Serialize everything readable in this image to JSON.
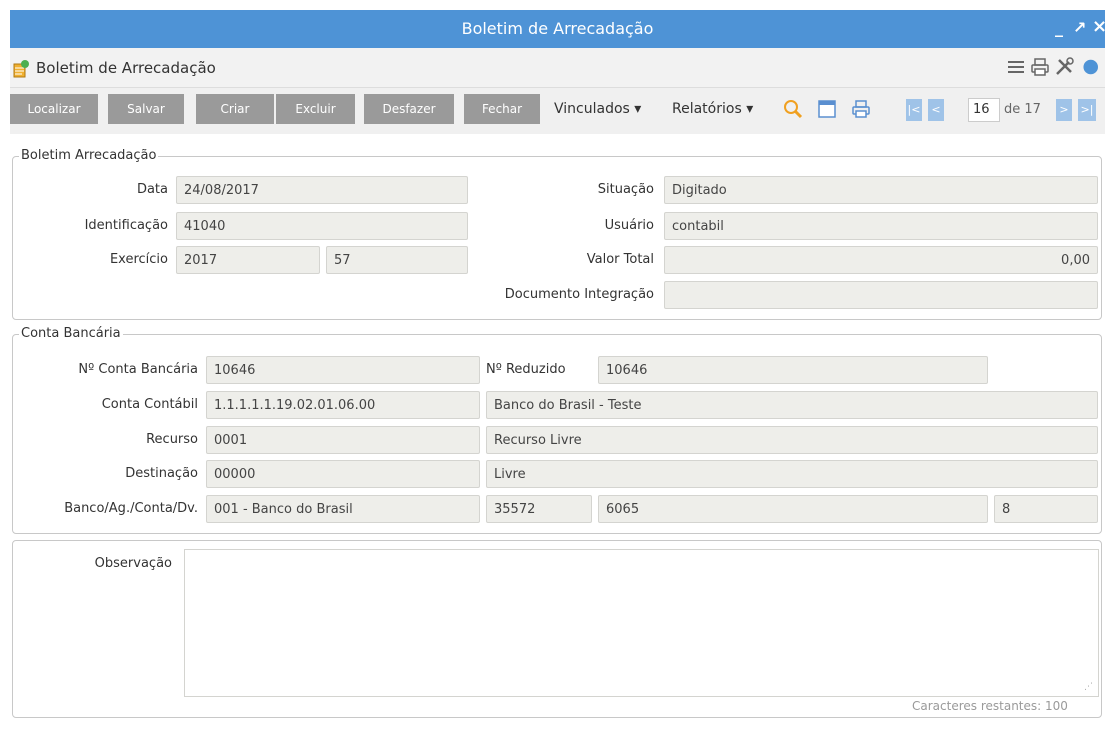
{
  "window": {
    "title": "Boletim de Arrecadação",
    "minimize_glyph": "_",
    "maximize_glyph": "↗",
    "close_glyph": "×"
  },
  "header": {
    "title": "Boletim de Arrecadação",
    "icons": [
      "menu-icon",
      "print-icon",
      "tools-icon",
      "help-icon"
    ]
  },
  "toolbar": {
    "buttons": [
      "Localizar",
      "Salvar",
      "Criar",
      "Excluir",
      "Desfazer",
      "Fechar"
    ],
    "menus": [
      "Vinculados ▾",
      "Relatórios ▾"
    ],
    "icons": [
      "search-icon",
      "window-icon",
      "print-icon"
    ],
    "pagination": {
      "first": "|<",
      "prev": "<",
      "next": ">",
      "last": ">|",
      "current": "16",
      "total_label": "de 17"
    }
  },
  "boletim": {
    "legend": "Boletim Arrecadação",
    "data_label": "Data",
    "data_value": "24/08/2017",
    "identificacao_label": "Identificação",
    "identificacao_value": "41040",
    "exercicio_label": "Exercício",
    "exercicio_value": "2017",
    "exercicio_num": "57",
    "situacao_label": "Situação",
    "situacao_value": "Digitado",
    "usuario_label": "Usuário",
    "usuario_value": "contabil",
    "valor_total_label": "Valor Total",
    "valor_total_value": "0,00",
    "documento_label": "Documento Integração",
    "documento_value": ""
  },
  "conta": {
    "legend": "Conta Bancária",
    "numero_label": "Nº Conta Bancária",
    "numero_value": "10646",
    "reduzido_label": "Nº Reduzido",
    "reduzido_value": "10646",
    "contabil_label": "Conta Contábil",
    "contabil_value": "1.1.1.1.1.19.02.01.06.00",
    "contabil_desc": "Banco do Brasil - Teste",
    "recurso_label": "Recurso",
    "recurso_value": "0001",
    "recurso_desc": "Recurso Livre",
    "destinacao_label": "Destinação",
    "destinacao_value": "00000",
    "destinacao_desc": "Livre",
    "banco_label": "Banco/Ag./Conta/Dv.",
    "banco_value": "001 - Banco do Brasil",
    "agencia_value": "35572",
    "conta_value": "6065",
    "dv_value": "8"
  },
  "observacao": {
    "label": "Observação",
    "value": "",
    "counter": "Caracteres restantes: 100"
  },
  "colors": {
    "titlebar": "#4e93d6",
    "button": "#9a9a9a",
    "input_bg": "#eeeeea",
    "nav": "#9fc3e8"
  }
}
